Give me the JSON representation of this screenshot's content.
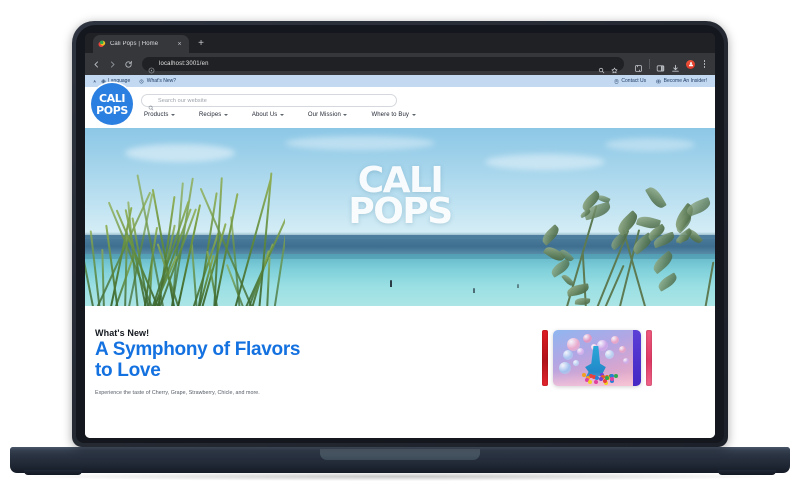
{
  "browser": {
    "tab": {
      "title": "Cali Pops | Home",
      "favicon": "cali-pops-favicon",
      "close_label": "×"
    },
    "new_tab_label": "+",
    "nav": {
      "back": "back-arrow-icon",
      "forward": "forward-arrow-icon",
      "reload": "reload-icon"
    },
    "omnibox": {
      "url": "localhost:3001/en",
      "site_info_icon": "info-circle-icon",
      "search_icon": "search-icon",
      "bookmark_icon": "star-icon"
    },
    "toolbar_icons": [
      "extensions-puzzle-icon",
      "split-view-icon",
      "download-icon",
      "profile-avatar-icon",
      "kebab-menu-icon"
    ]
  },
  "site": {
    "utility_bar": {
      "language_label": "Language",
      "whats_new_label": "What's New?",
      "contact_label": "Contact Us",
      "insider_label": "Become An Insider!"
    },
    "logo": {
      "line1": "CALI",
      "line2": "POPS",
      "color": "#2b7fe0"
    },
    "search": {
      "placeholder": "Search our website"
    },
    "nav_items": [
      {
        "label": "Products"
      },
      {
        "label": "Recipes"
      },
      {
        "label": "About Us"
      },
      {
        "label": "Our Mission"
      },
      {
        "label": "Where to Buy"
      }
    ],
    "hero": {
      "logo_line1": "CALI",
      "logo_line2": "POPS"
    },
    "whats_new": {
      "kicker": "What's New!",
      "title_line1": "A Symphony of Flavors",
      "title_line2": "to Love",
      "subcopy": "Experience the taste of Cherry, Grape, Strawberry, Chicle, and more.",
      "title_color": "#1471e0"
    }
  }
}
